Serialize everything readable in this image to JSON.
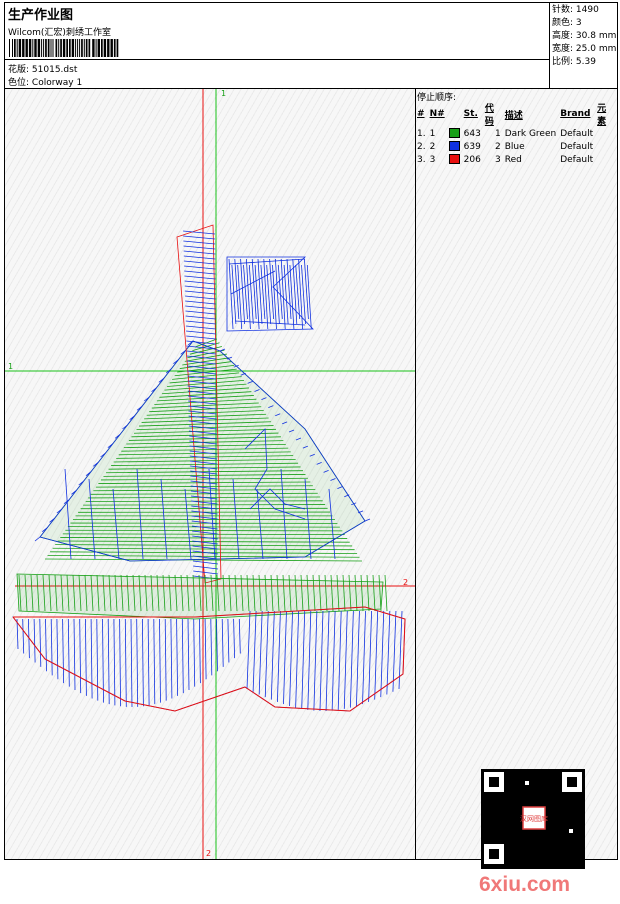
{
  "header": {
    "title": "生产作业图",
    "company": "Wilcom(汇宏)刺绣工作室",
    "design_label": "花版:",
    "design_value": "51015.dst",
    "colorway_label": "色位:",
    "colorway_value": "Colorway 1"
  },
  "stats": [
    {
      "label": "针数:",
      "value": "1490"
    },
    {
      "label": "颜色:",
      "value": "3"
    },
    {
      "label": "高度:",
      "value": "30.8 mm"
    },
    {
      "label": "宽度:",
      "value": "25.0 mm"
    },
    {
      "label": "比例:",
      "value": "5.39"
    }
  ],
  "stop_sequence": {
    "title": "停止顺序:",
    "columns": [
      "#",
      "N#",
      "St.",
      "代码",
      "描述",
      "Brand",
      "元素"
    ],
    "rows": [
      {
        "idx": "1.",
        "n": "1",
        "color": "#18a018",
        "stitches": "643",
        "code": "1",
        "desc": "Dark Green",
        "brand": "Default"
      },
      {
        "idx": "2.",
        "n": "2",
        "color": "#1030e0",
        "stitches": "639",
        "code": "2",
        "desc": "Blue",
        "brand": "Default"
      },
      {
        "idx": "3.",
        "n": "3",
        "color": "#e81010",
        "stitches": "206",
        "code": "3",
        "desc": "Red",
        "brand": "Default"
      }
    ]
  },
  "axes": {
    "v1_label": "1",
    "h1_label": "1",
    "h2_label": "2",
    "v2_label": "2"
  },
  "watermark": {
    "text": "6xiu.com",
    "badge": "汉网图库"
  }
}
